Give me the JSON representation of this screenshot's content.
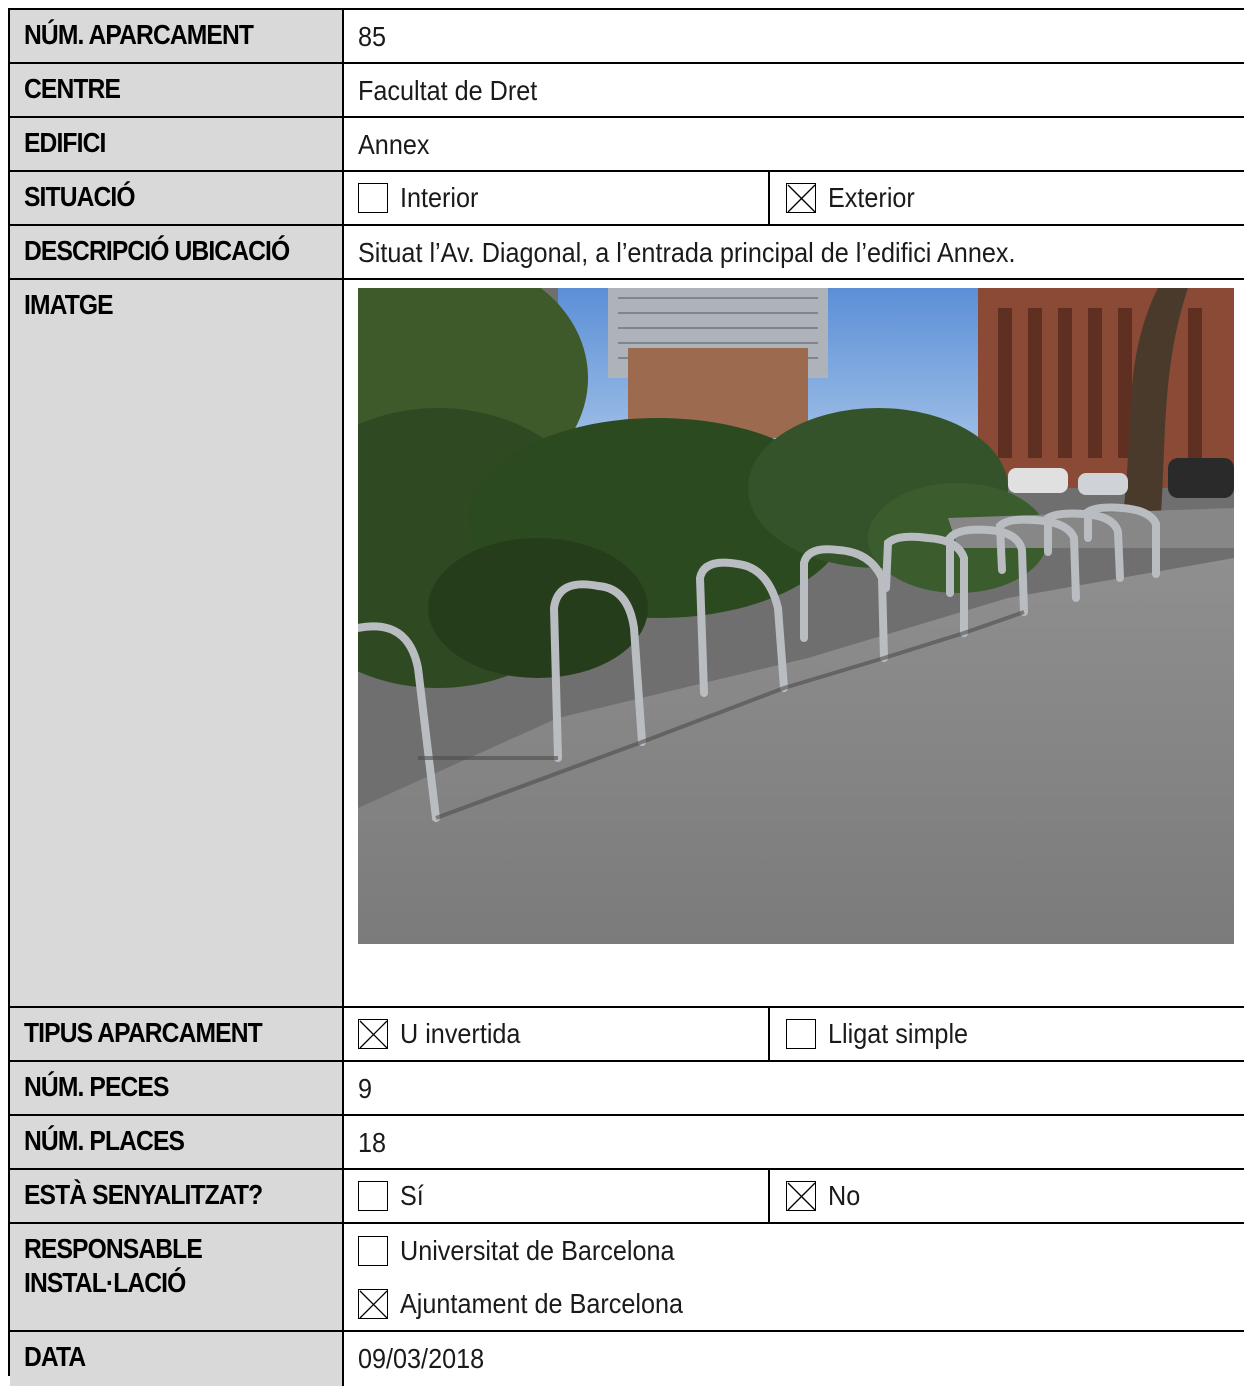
{
  "fields": {
    "num_aparcament": {
      "label": "NÚM. APARCAMENT",
      "value": "85"
    },
    "centre": {
      "label": "CENTRE",
      "value": "Facultat de Dret"
    },
    "edifici": {
      "label": "EDIFICI",
      "value": "Annex"
    },
    "situacio": {
      "label": "SITUACIÓ",
      "options": [
        {
          "text": "Interior",
          "checked": false
        },
        {
          "text": "Exterior",
          "checked": true
        }
      ]
    },
    "descripcio": {
      "label": "DESCRIPCIÓ UBICACIÓ",
      "value": "Situat l’Av. Diagonal, a l’entrada principal de l’edifici Annex."
    },
    "imatge": {
      "label": "IMATGE"
    },
    "tipus": {
      "label": "TIPUS APARCAMENT",
      "options": [
        {
          "text": "U invertida",
          "checked": true
        },
        {
          "text": "Lligat simple",
          "checked": false
        }
      ]
    },
    "num_peces": {
      "label": "NÚM. PECES",
      "value": "9"
    },
    "num_places": {
      "label": "NÚM. PLACES",
      "value": "18"
    },
    "senyalitzat": {
      "label": "ESTÀ SENYALITZAT?",
      "options": [
        {
          "text": "Sí",
          "checked": false
        },
        {
          "text": "No",
          "checked": true
        }
      ]
    },
    "responsable": {
      "label_line1": "RESPONSABLE",
      "label_line2": "INSTAL·LACIÓ",
      "options": [
        {
          "text": "Universitat de Barcelona",
          "checked": false
        },
        {
          "text": "Ajuntament de Barcelona",
          "checked": true
        }
      ]
    },
    "data": {
      "label": "DATA",
      "value": "09/03/2018"
    }
  }
}
